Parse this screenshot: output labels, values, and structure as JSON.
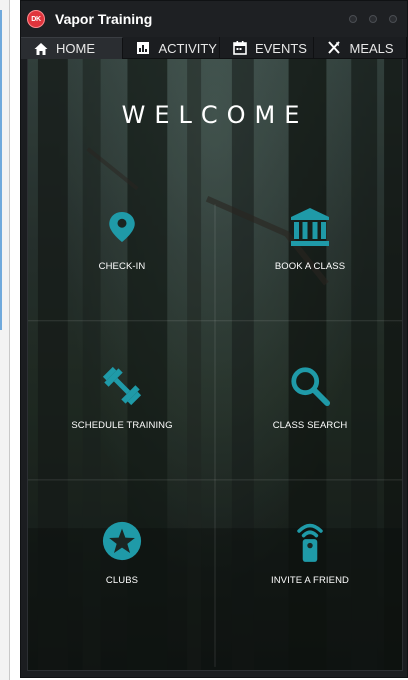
{
  "window": {
    "title": "Vapor Training",
    "logo_text": "DK",
    "accent_color": "#1f9aa8",
    "logo_color": "#e0343c"
  },
  "tabs": [
    {
      "label": "HOME",
      "icon": "home-icon",
      "active": true
    },
    {
      "label": "ACTIVITY",
      "icon": "chart-icon",
      "active": false
    },
    {
      "label": "EVENTS",
      "icon": "calendar-icon",
      "active": false
    },
    {
      "label": "MEALS",
      "icon": "utensils-icon",
      "active": false
    }
  ],
  "main": {
    "welcome": "WELCOME",
    "tiles": [
      {
        "label": "CHECK-IN",
        "icon": "map-pin-icon"
      },
      {
        "label": "BOOK A CLASS",
        "icon": "institution-icon"
      },
      {
        "label": "SCHEDULE TRAINING",
        "icon": "dumbbell-icon"
      },
      {
        "label": "CLASS SEARCH",
        "icon": "search-icon"
      },
      {
        "label": "CLUBS",
        "icon": "star-icon"
      },
      {
        "label": "INVITE A FRIEND",
        "icon": "remote-signal-icon"
      }
    ]
  }
}
